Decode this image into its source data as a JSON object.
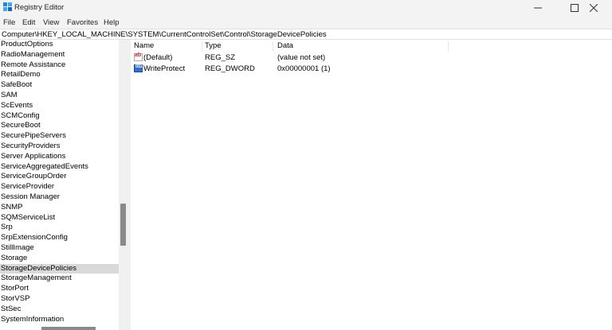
{
  "window": {
    "title": "Registry Editor",
    "icons": {
      "app": "registry-editor-icon",
      "minimize": "minimize-icon",
      "maximize": "maximize-icon",
      "close": "close-icon"
    }
  },
  "menu": [
    "File",
    "Edit",
    "View",
    "Favorites",
    "Help"
  ],
  "address": "Computer\\HKEY_LOCAL_MACHINE\\SYSTEM\\CurrentControlSet\\Control\\StorageDevicePolicies",
  "tree": {
    "items": [
      "ProductOptions",
      "RadioManagement",
      "Remote Assistance",
      "RetailDemo",
      "SafeBoot",
      "SAM",
      "ScEvents",
      "SCMConfig",
      "SecureBoot",
      "SecurePipeServers",
      "SecurityProviders",
      "Server Applications",
      "ServiceAggregatedEvents",
      "ServiceGroupOrder",
      "ServiceProvider",
      "Session Manager",
      "SNMP",
      "SQMServiceList",
      "Srp",
      "SrpExtensionConfig",
      "StillImage",
      "Storage",
      "StorageDevicePolicies",
      "StorageManagement",
      "StorPort",
      "StorVSP",
      "StSec",
      "SystemInformation"
    ],
    "selected": "StorageDevicePolicies"
  },
  "list": {
    "columns": {
      "name": "Name",
      "type": "Type",
      "data": "Data"
    },
    "rows": [
      {
        "icon": "string-value-icon",
        "name": "(Default)",
        "type": "REG_SZ",
        "data": "(value not set)"
      },
      {
        "icon": "dword-value-icon",
        "name": "WriteProtect",
        "type": "REG_DWORD",
        "data": "0x00000001 (1)"
      }
    ],
    "icon_glyphs": {
      "sz": "ab",
      "dword": "011"
    }
  }
}
